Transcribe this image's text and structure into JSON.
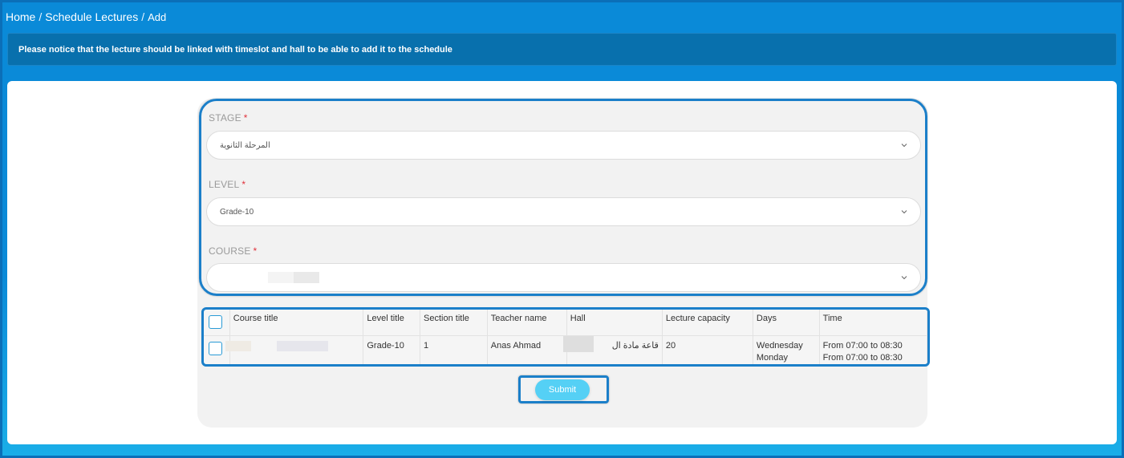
{
  "breadcrumb": {
    "home": "Home",
    "separator": "/",
    "schedule": "Schedule Lectures",
    "current": "Add"
  },
  "notice": {
    "text": "Please notice that the lecture should be linked with timeslot and hall to be able to add it to the schedule"
  },
  "form": {
    "stage": {
      "label": "STAGE",
      "required": "*",
      "value": "المرحلة الثانوية"
    },
    "level": {
      "label": "LEVEL",
      "required": "*",
      "value": "Grade-10"
    },
    "course": {
      "label": "COURSE",
      "required": "*",
      "value": ""
    }
  },
  "table": {
    "headers": {
      "course_title": "Course title",
      "level_title": "Level title",
      "section_title": "Section title",
      "teacher_name": "Teacher name",
      "hall": "Hall",
      "lecture_capacity": "Lecture capacity",
      "days": "Days",
      "time": "Time"
    },
    "rows": [
      {
        "course_title": "",
        "level_title": "Grade-10",
        "section_title": "1",
        "teacher_name": "Anas Ahmad",
        "hall": "قاعة مادة ال",
        "lecture_capacity": "20",
        "days": [
          "Wednesday",
          "Monday"
        ],
        "time": [
          "From 07:00 to 08:30",
          "From 07:00 to 08:30"
        ]
      }
    ]
  },
  "submit": {
    "label": "Submit"
  },
  "colors": {
    "background": "#0a8ad8",
    "notice": "#0870ad",
    "highlight_border": "#1b7fc9",
    "submit": "#55d0f5",
    "required": "#e0313b"
  }
}
